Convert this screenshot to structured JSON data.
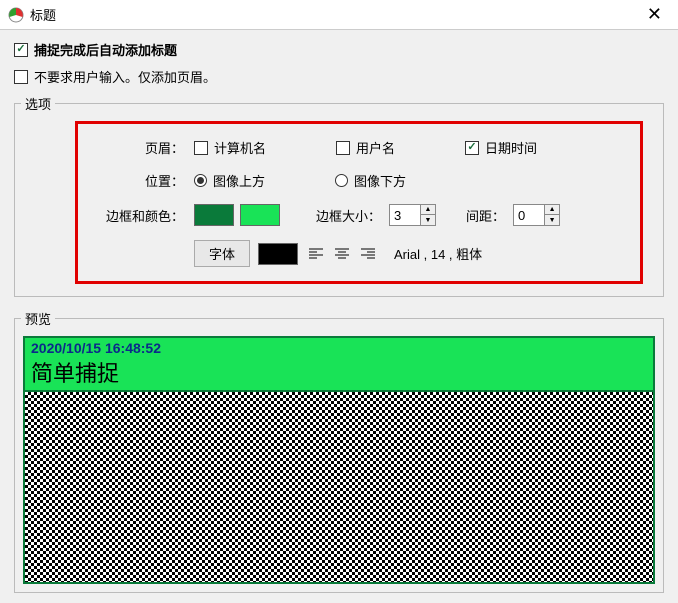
{
  "titlebar": {
    "title": "标题"
  },
  "top_checks": {
    "auto_add": {
      "label": "捕捉完成后自动添加标题",
      "checked": true
    },
    "no_input": {
      "label": "不要求用户输入。仅添加页眉。",
      "checked": false
    }
  },
  "options": {
    "legend": "选项",
    "header_label": "页眉：",
    "computer_name": {
      "label": "计算机名",
      "checked": false
    },
    "user_name": {
      "label": "用户名",
      "checked": false
    },
    "date_time": {
      "label": "日期时间",
      "checked": true
    },
    "position_label": "位置：",
    "above": {
      "label": "图像上方",
      "checked": true
    },
    "below": {
      "label": "图像下方",
      "checked": false
    },
    "border_color_label": "边框和颜色：",
    "color1": "#0a7a3a",
    "color2": "#19e357",
    "border_size_label": "边框大小：",
    "border_size": "3",
    "spacing_label": "间距：",
    "spacing": "0",
    "font_btn": "字体",
    "font_color": "#000000",
    "font_desc": "Arial , 14 , 粗体"
  },
  "preview": {
    "legend": "预览",
    "timestamp": "2020/10/15 16:48:52",
    "title": "简单捕捉"
  }
}
